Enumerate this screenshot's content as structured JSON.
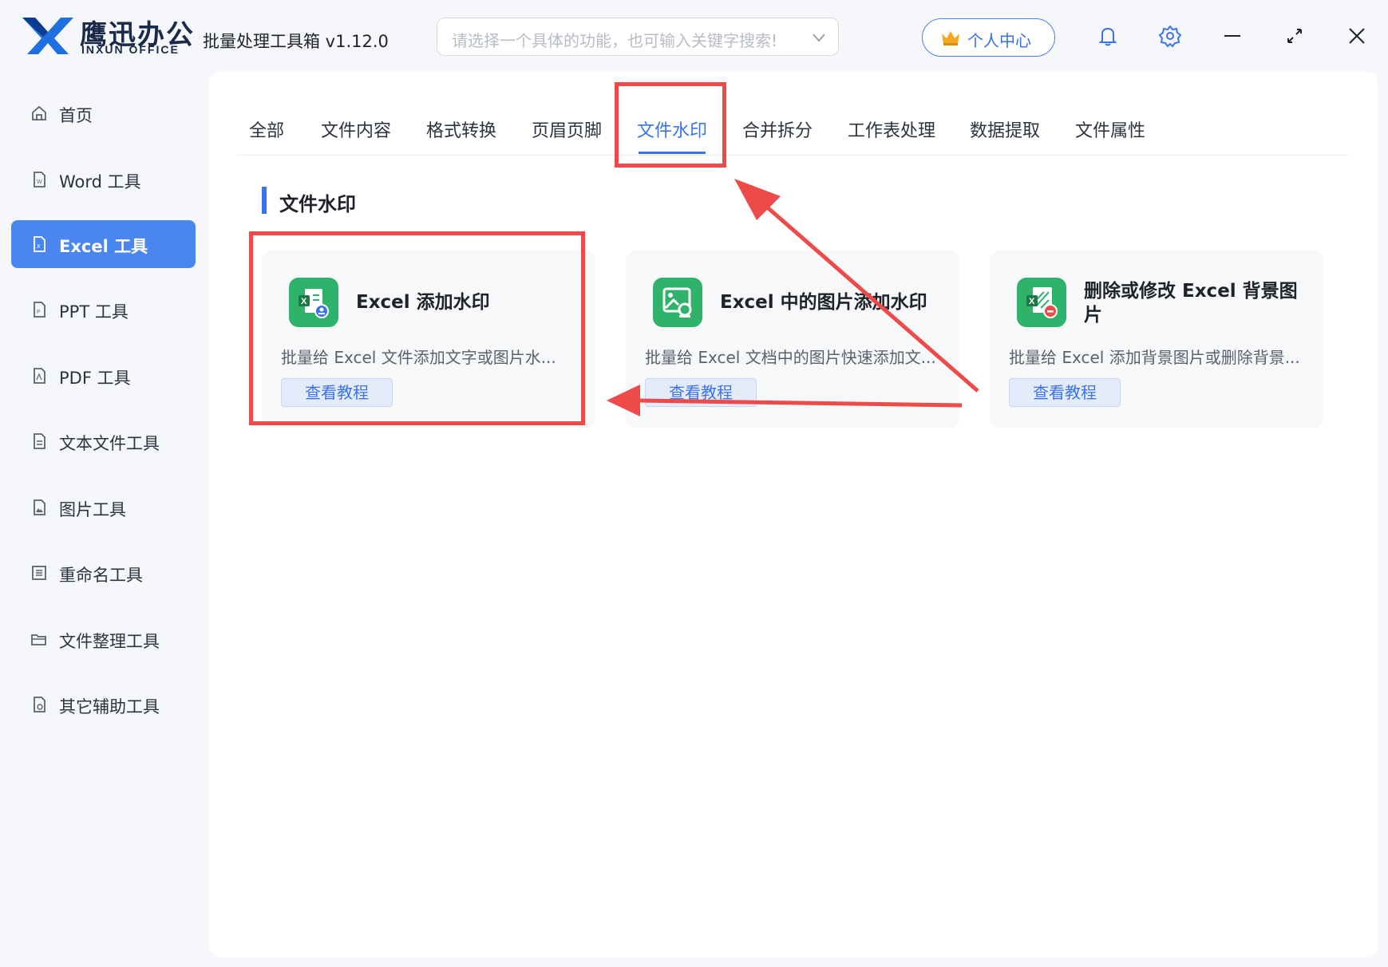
{
  "app": {
    "logo_cn": "鹰迅办公",
    "logo_en": "INXUN OFFICE",
    "title": "批量处理工具箱 v1.12.0",
    "search_placeholder": "请选择一个具体的功能，也可输入关键字搜索!",
    "user_center": "个人中心",
    "accent": "#3b74ea"
  },
  "sidebar": {
    "items": [
      {
        "label": "首页",
        "icon": "home-icon"
      },
      {
        "label": "Word 工具",
        "icon": "word-file-icon"
      },
      {
        "label": "Excel 工具",
        "icon": "excel-file-icon",
        "active": true
      },
      {
        "label": "PPT 工具",
        "icon": "ppt-file-icon"
      },
      {
        "label": "PDF 工具",
        "icon": "pdf-file-icon"
      },
      {
        "label": "文本文件工具",
        "icon": "text-file-icon"
      },
      {
        "label": "图片工具",
        "icon": "image-file-icon"
      },
      {
        "label": "重命名工具",
        "icon": "rename-icon"
      },
      {
        "label": "文件整理工具",
        "icon": "folder-icon"
      },
      {
        "label": "其它辅助工具",
        "icon": "other-tools-icon"
      }
    ]
  },
  "tabs": [
    {
      "label": "全部"
    },
    {
      "label": "文件内容"
    },
    {
      "label": "格式转换"
    },
    {
      "label": "页眉页脚"
    },
    {
      "label": "文件水印",
      "active": true
    },
    {
      "label": "合并拆分"
    },
    {
      "label": "工作表处理"
    },
    {
      "label": "数据提取"
    },
    {
      "label": "文件属性"
    }
  ],
  "section": {
    "title": "文件水印"
  },
  "cards": [
    {
      "title": "Excel 添加水印",
      "desc": "批量给 Excel 文件添加文字或图片水...",
      "button": "查看教程",
      "icon": "excel-watermark-icon"
    },
    {
      "title": "Excel 中的图片添加水印",
      "desc": "批量给 Excel 文档中的图片快速添加文...",
      "button": "查看教程",
      "icon": "excel-image-watermark-icon"
    },
    {
      "title": "删除或修改 Excel 背景图片",
      "desc": "批量给 Excel 添加背景图片或删除背景...",
      "button": "查看教程",
      "icon": "excel-background-icon"
    }
  ]
}
